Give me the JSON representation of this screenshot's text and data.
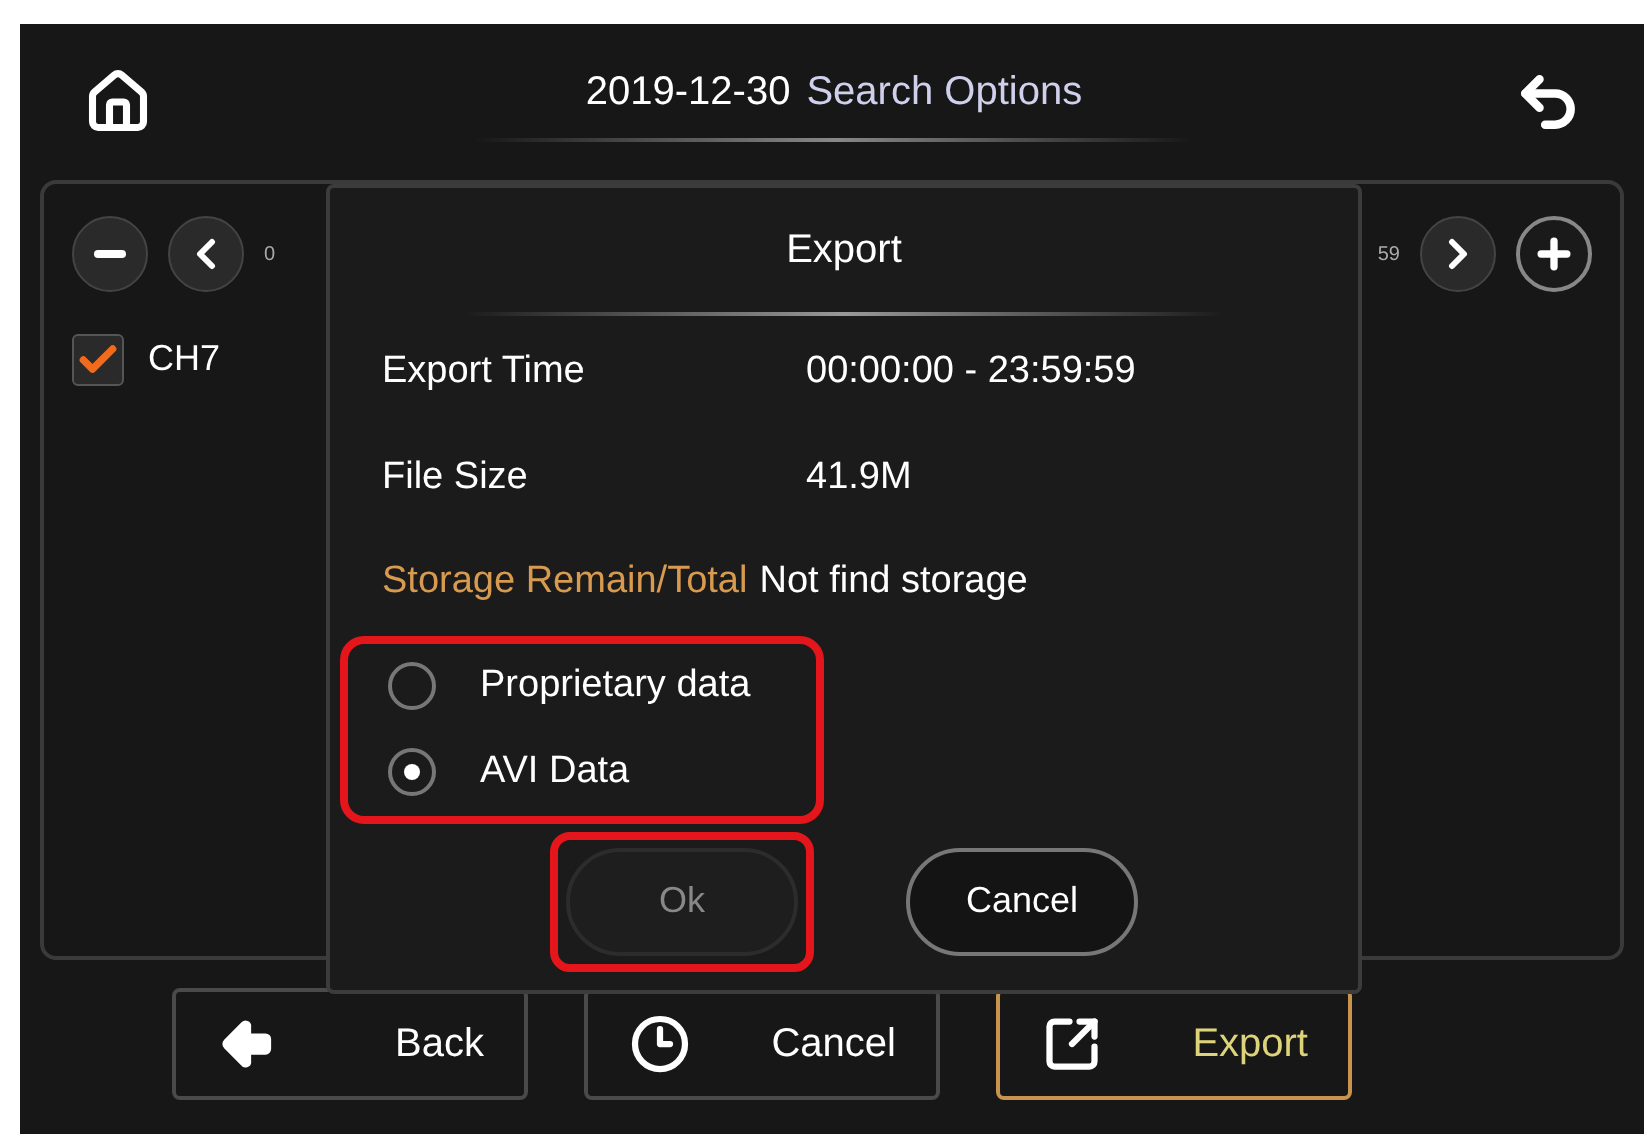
{
  "header": {
    "date": "2019-12-30",
    "title": "Search Options"
  },
  "timeline": {
    "start": "0",
    "end": "59"
  },
  "channels": [
    {
      "label": "CH7",
      "checked": true
    }
  ],
  "dialog": {
    "title": "Export",
    "rows": [
      {
        "label": "Export Time",
        "value": "00:00:00 - 23:59:59",
        "kind": "plain"
      },
      {
        "label": "File Size",
        "value": "41.9M",
        "kind": "plain"
      },
      {
        "label": "Storage Remain/Total",
        "value": "Not find storage",
        "kind": "warning"
      }
    ],
    "formats_highlighted": true,
    "formats": [
      {
        "label": "Proprietary data",
        "selected": false
      },
      {
        "label": "AVI Data",
        "selected": true
      }
    ],
    "buttons": [
      {
        "label": "Ok",
        "disabled": true,
        "highlighted": true
      },
      {
        "label": "Cancel",
        "disabled": false,
        "highlighted": false
      }
    ]
  },
  "toolbar": [
    {
      "label": "Back",
      "kind": "back",
      "selected": false
    },
    {
      "label": "Cancel",
      "kind": "cancel",
      "selected": false
    },
    {
      "label": "Export",
      "kind": "export",
      "selected": true
    }
  ]
}
